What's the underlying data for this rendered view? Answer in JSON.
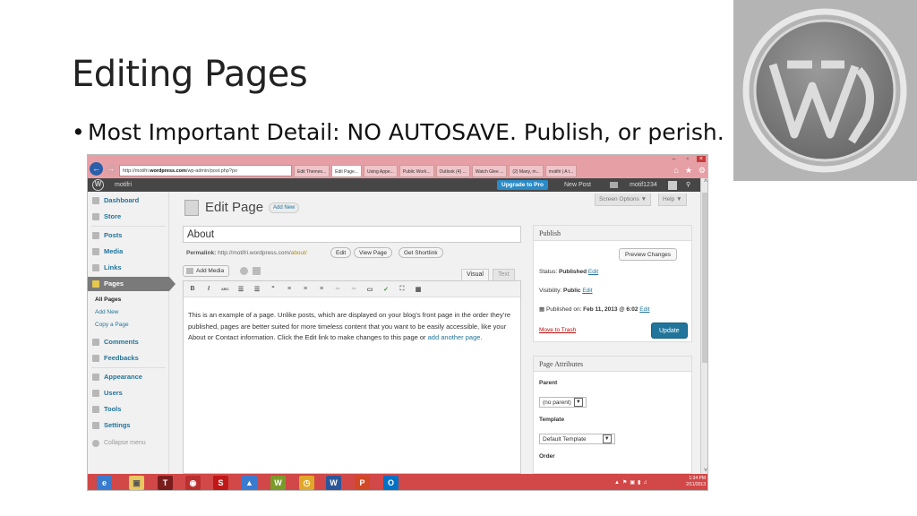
{
  "slide": {
    "title": "Editing Pages",
    "bullet_marker": "•",
    "bullet": "Most Important Detail: NO AUTOSAVE. Publish, or perish."
  },
  "browser": {
    "address_prefix": "http://motifri.",
    "address_domain": "wordpress.com",
    "address_rest": "/wp-admin/post.php?po",
    "tabs": [
      "Edit Themes...",
      "Edit Page...",
      "Using Appe...",
      "Public Work...",
      "Outlook (4) ...",
      "Watch Glee ...",
      "(2) Many, m...",
      "motifri | A t..."
    ],
    "window_controls": [
      "–",
      "▫",
      "×"
    ]
  },
  "admin_bar": {
    "site": "motifri",
    "upgrade": "Upgrade to Pro",
    "new_post": "New Post",
    "user": "motif1234"
  },
  "sidebar": {
    "items": [
      {
        "label": "Dashboard"
      },
      {
        "label": "Store"
      },
      {
        "label": "Posts"
      },
      {
        "label": "Media"
      },
      {
        "label": "Links"
      },
      {
        "label": "Pages"
      },
      {
        "label": "Comments"
      },
      {
        "label": "Feedbacks"
      },
      {
        "label": "Appearance"
      },
      {
        "label": "Users"
      },
      {
        "label": "Tools"
      },
      {
        "label": "Settings"
      },
      {
        "label": "Collapse menu"
      }
    ],
    "submenu": [
      "All Pages",
      "Add New",
      "Copy a Page"
    ]
  },
  "main": {
    "heading": "Edit Page",
    "add_new": "Add New",
    "screen_options": "Screen Options ▼",
    "help": "Help ▼",
    "title_value": "About",
    "permalink_label": "Permalink:",
    "permalink_base": "http://motifri.wordpress.com/",
    "permalink_slug": "about/",
    "permalink_buttons": [
      "Edit",
      "View Page",
      "Get Shortlink"
    ],
    "add_media": "Add Media",
    "tab_visual": "Visual",
    "tab_text": "Text",
    "toolbar": [
      "B",
      "I",
      "ABC",
      "☰",
      "☰",
      "“",
      "≡",
      "≡",
      "≡",
      "∞",
      "∞",
      "▭",
      "✓",
      "⛶",
      "▦"
    ],
    "body_text": "This is an example of a page. Unlike posts, which are displayed on your blog’s front page in the order they’re published, pages are better suited for more timeless content that you want to be easily accessible, like your About or Contact information. Click the Edit link to make changes to this page or ",
    "body_link": "add another page",
    "body_end": "."
  },
  "publish": {
    "title": "Publish",
    "preview": "Preview Changes",
    "status_label": "Status:",
    "status_value": "Published",
    "visibility_label": "Visibility:",
    "visibility_value": "Public",
    "published_label": "Published on:",
    "published_value": "Feb 11, 2013 @ 6:02",
    "edit": "Edit",
    "trash": "Move to Trash",
    "update": "Update"
  },
  "attributes": {
    "title": "Page Attributes",
    "parent_label": "Parent",
    "parent_value": "(no parent)",
    "template_label": "Template",
    "template_value": "Default Template",
    "order_label": "Order"
  },
  "taskbar": {
    "time": "1:34 PM",
    "date": "2/11/2013"
  },
  "colors": {
    "browser_chrome": "#e79fa6",
    "taskbar": "#d24848",
    "wp_link": "#21759b",
    "logo_bg": "#b4b4b4"
  }
}
